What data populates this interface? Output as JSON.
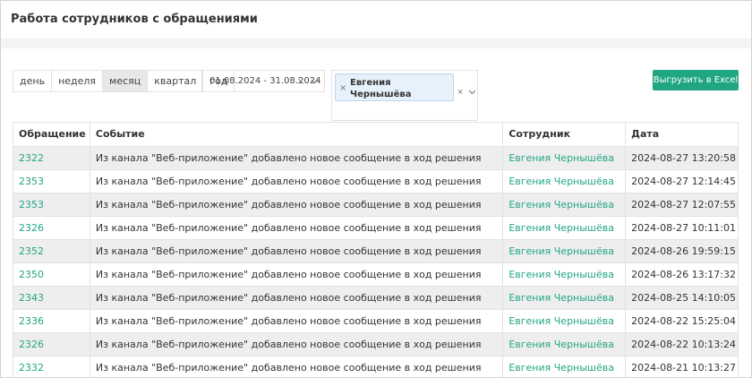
{
  "page": {
    "title": "Работа сотрудников с обращениями"
  },
  "periods": [
    {
      "label": "день",
      "active": false
    },
    {
      "label": "неделя",
      "active": false
    },
    {
      "label": "месяц",
      "active": true
    },
    {
      "label": "квартал",
      "active": false
    },
    {
      "label": "год",
      "active": false
    }
  ],
  "date_range": {
    "value": "01.08.2024 - 31.08.2024"
  },
  "employee_filter": {
    "selected": "Евгения Чернышёва"
  },
  "export_button": {
    "label": "Выгрузить в Excel"
  },
  "colors": {
    "accent": "#21a684",
    "chip_bg": "#e7f1fb",
    "stripe": "#eeeeee"
  },
  "icons": {
    "clear": "×",
    "dropdown": "chevron-down"
  },
  "table": {
    "columns": [
      "Обращение",
      "Событие",
      "Сотрудник",
      "Дата"
    ],
    "rows": [
      {
        "ticket": "2322",
        "event": "Из канала \"Веб-приложение\" добавлено новое сообщение в ход решения",
        "employee": "Евгения Чернышёва",
        "date": "2024-08-27 13:20:58"
      },
      {
        "ticket": "2353",
        "event": "Из канала \"Веб-приложение\" добавлено новое сообщение в ход решения",
        "employee": "Евгения Чернышёва",
        "date": "2024-08-27 12:14:45"
      },
      {
        "ticket": "2353",
        "event": "Из канала \"Веб-приложение\" добавлено новое сообщение в ход решения",
        "employee": "Евгения Чернышёва",
        "date": "2024-08-27 12:07:55"
      },
      {
        "ticket": "2326",
        "event": "Из канала \"Веб-приложение\" добавлено новое сообщение в ход решения",
        "employee": "Евгения Чернышёва",
        "date": "2024-08-27 10:11:01"
      },
      {
        "ticket": "2352",
        "event": "Из канала \"Веб-приложение\" добавлено новое сообщение в ход решения",
        "employee": "Евгения Чернышёва",
        "date": "2024-08-26 19:59:15"
      },
      {
        "ticket": "2350",
        "event": "Из канала \"Веб-приложение\" добавлено новое сообщение в ход решения",
        "employee": "Евгения Чернышёва",
        "date": "2024-08-26 13:17:32"
      },
      {
        "ticket": "2343",
        "event": "Из канала \"Веб-приложение\" добавлено новое сообщение в ход решения",
        "employee": "Евгения Чернышёва",
        "date": "2024-08-25 14:10:05"
      },
      {
        "ticket": "2336",
        "event": "Из канала \"Веб-приложение\" добавлено новое сообщение в ход решения",
        "employee": "Евгения Чернышёва",
        "date": "2024-08-22 15:25:04"
      },
      {
        "ticket": "2326",
        "event": "Из канала \"Веб-приложение\" добавлено новое сообщение в ход решения",
        "employee": "Евгения Чернышёва",
        "date": "2024-08-22 10:13:24"
      },
      {
        "ticket": "2332",
        "event": "Из канала \"Веб-приложение\" добавлено новое сообщение в ход решения",
        "employee": "Евгения Чернышёва",
        "date": "2024-08-21 10:13:27"
      }
    ]
  }
}
